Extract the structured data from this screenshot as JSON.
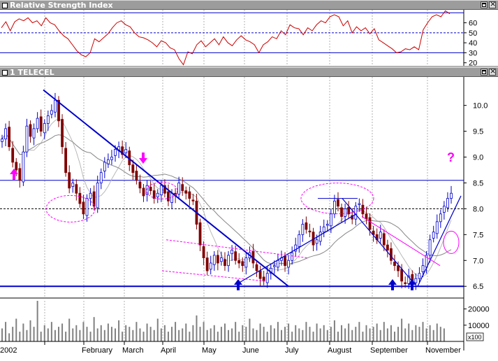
{
  "rsi_window": {
    "title": "Relative Strength Index"
  },
  "price_window": {
    "title": "1 TELECEL"
  },
  "colors": {
    "panel_bg": "#ffffff",
    "grid": "#b0b0b0",
    "rsi_line": "#cc0000",
    "rsi_levels": "#0000cc",
    "trendline": "#0000cc",
    "moving_average": "#888888",
    "magenta": "#ff00ff",
    "volume": "#808080",
    "candle_up": "#0000cc",
    "candle_down": "#800000"
  },
  "chart_data": [
    {
      "type": "line",
      "name": "rsi_panel",
      "yticks": [
        "60",
        "50",
        "40",
        "30",
        "20"
      ],
      "ytick_values": [
        60,
        50,
        40,
        30,
        20
      ],
      "ylim": [
        17,
        73
      ],
      "levels": [
        70,
        50,
        30
      ],
      "series": [
        {
          "values": [
            55,
            61,
            52,
            61,
            64,
            62,
            65,
            60,
            62,
            57,
            65,
            60,
            58,
            52,
            47,
            44,
            38,
            32,
            28,
            26,
            30,
            44,
            41,
            45,
            49,
            55,
            60,
            62,
            58,
            56,
            50,
            46,
            45,
            43,
            40,
            36,
            42,
            40,
            35,
            33,
            24,
            18,
            31,
            29,
            38,
            42,
            36,
            40,
            44,
            38,
            46,
            40,
            37,
            43,
            47,
            43,
            41,
            38,
            30,
            38,
            41,
            46,
            44,
            52,
            48,
            58,
            55,
            54,
            48,
            55,
            52,
            58,
            62,
            60,
            66,
            68,
            66,
            57,
            62,
            50,
            56,
            52,
            55,
            49,
            54,
            43,
            40,
            37,
            34,
            30,
            31,
            34,
            33,
            36,
            33,
            53,
            60,
            66,
            68,
            66,
            72,
            69
          ]
        }
      ]
    },
    {
      "type": "candlestick",
      "name": "price_panel",
      "xticks": [
        "2002",
        "February",
        "March",
        "April",
        "May",
        "June",
        "July",
        "August",
        "September",
        "November"
      ],
      "yticks": [
        "10.0",
        "9.5",
        "9.0",
        "8.5",
        "8.0",
        "7.5",
        "7.0",
        "6.5"
      ],
      "ytick_values": [
        10.0,
        9.5,
        9.0,
        8.5,
        8.0,
        7.5,
        7.0,
        6.5
      ],
      "ylim": [
        6.3,
        10.55
      ],
      "close": [
        9.35,
        9.55,
        9.2,
        8.9,
        8.75,
        8.55,
        9.1,
        9.6,
        9.4,
        9.55,
        9.75,
        9.5,
        9.65,
        9.8,
        9.9,
        10.1,
        9.7,
        9.2,
        8.7,
        8.4,
        8.5,
        8.3,
        8.1,
        7.9,
        8.2,
        8.3,
        8.05,
        8.5,
        8.7,
        8.9,
        8.95,
        9.0,
        9.15,
        9.2,
        9.05,
        9.15,
        8.85,
        8.7,
        8.55,
        8.4,
        8.25,
        8.45,
        8.35,
        8.2,
        8.3,
        8.45,
        8.3,
        8.15,
        8.3,
        8.25,
        8.5,
        8.35,
        8.3,
        8.2,
        8.15,
        7.7,
        7.3,
        7.05,
        6.8,
        6.95,
        7.1,
        6.95,
        7.05,
        6.9,
        7.1,
        7.2,
        7.0,
        6.95,
        6.9,
        7.05,
        7.15,
        6.95,
        6.8,
        6.65,
        6.6,
        6.75,
        6.85,
        6.9,
        7.0,
        7.05,
        6.9,
        7.0,
        7.15,
        7.3,
        7.5,
        7.7,
        7.6,
        7.55,
        7.3,
        7.4,
        7.55,
        7.65,
        7.7,
        7.9,
        8.15,
        8.05,
        7.85,
        8.0,
        7.9,
        7.8,
        8.05,
        8.1,
        7.9,
        7.8,
        7.6,
        7.5,
        7.4,
        7.55,
        7.3,
        7.2,
        7.0,
        6.9,
        6.8,
        6.6,
        6.55,
        6.7,
        6.6,
        6.65,
        6.75,
        6.9,
        7.1,
        7.4,
        7.55,
        7.75,
        7.9,
        8.05,
        8.2,
        8.3
      ],
      "volume_axis": {
        "yticks": [
          "20000",
          "10000"
        ],
        "ytick_values": [
          20000,
          10000
        ],
        "ylim": [
          0,
          25000
        ],
        "unit_label": "x100"
      },
      "volume": [
        8000,
        12000,
        5000,
        9000,
        14000,
        6000,
        11000,
        7000,
        13000,
        9000,
        25000,
        6000,
        10000,
        8000,
        12000,
        7000,
        9000,
        11000,
        6000,
        14000,
        8000,
        10000,
        7000,
        12000,
        9000,
        6000,
        15000,
        8000,
        10000,
        7000,
        11000,
        9000,
        8000,
        13000,
        6000,
        10000,
        9000,
        7000,
        12000,
        8000,
        6000,
        11000,
        9000,
        7000,
        14000,
        8000,
        10000,
        6000,
        9000,
        12000,
        7000,
        8000,
        11000,
        6000,
        10000,
        16000,
        9000,
        12000,
        7000,
        8000,
        10000,
        6000,
        9000,
        11000,
        7000,
        8000,
        12000,
        6000,
        10000,
        9000,
        14000,
        8000,
        7000,
        11000,
        9000,
        6000,
        10000,
        8000,
        12000,
        7000,
        9000,
        11000,
        6000,
        10000,
        8000,
        7000,
        12000,
        9000,
        6000,
        11000,
        8000,
        10000,
        7000,
        9000,
        13000,
        6000,
        10000,
        8000,
        11000,
        7000,
        9000,
        12000,
        6000,
        10000,
        8000,
        9000,
        11000,
        7000,
        12000,
        8000,
        10000,
        6000,
        9000,
        14000,
        8000,
        11000,
        7000,
        10000,
        9000,
        12000,
        8000,
        10000,
        7000,
        11000,
        9000,
        8000
      ]
    }
  ],
  "annotations": {
    "question_mark": "?"
  }
}
